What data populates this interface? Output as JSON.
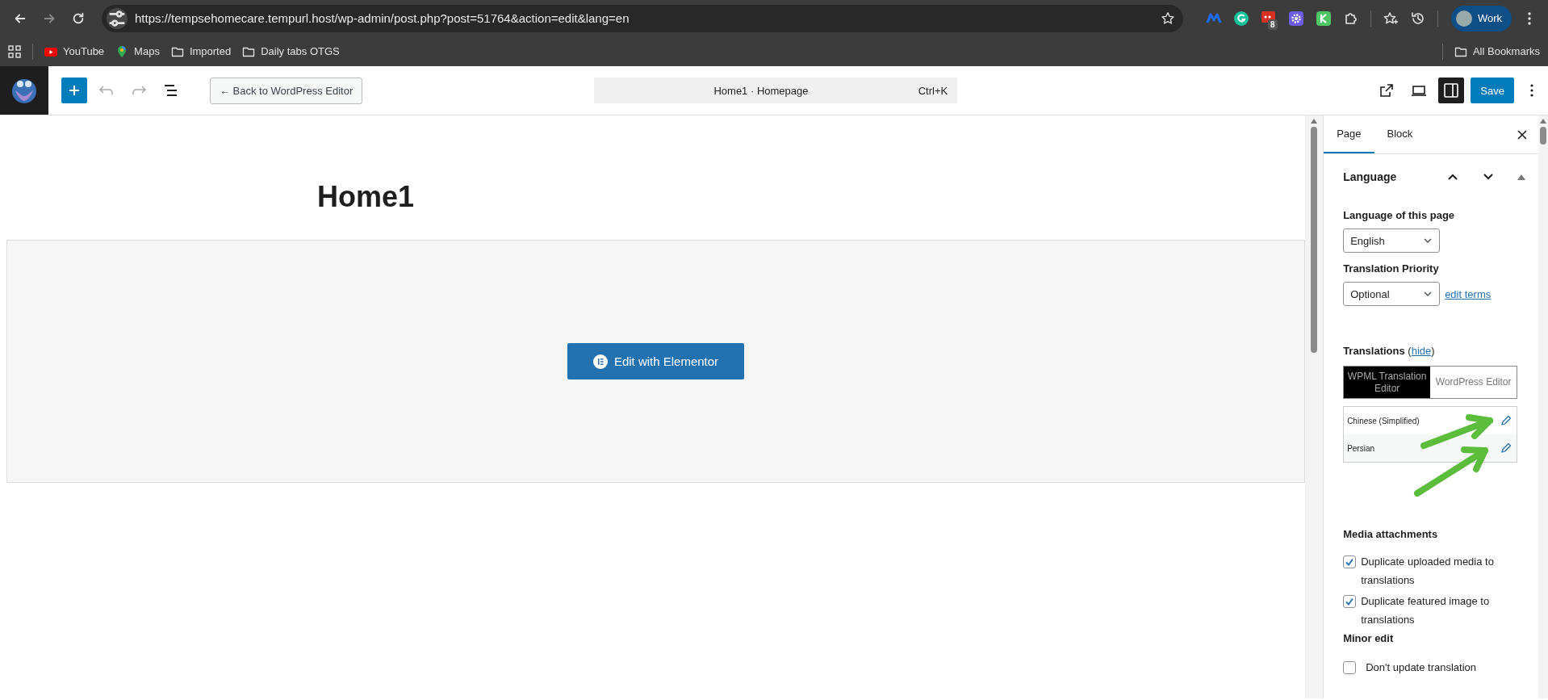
{
  "browser": {
    "url": "https://tempsehomecare.tempurl.host/wp-admin/post.php?post=51764&action=edit&lang=en",
    "extension_badge": "8",
    "profile": {
      "label": "Work"
    },
    "bookmarks": [
      {
        "label": "YouTube",
        "kind": "youtube"
      },
      {
        "label": "Maps",
        "kind": "maps"
      },
      {
        "label": "Imported",
        "kind": "folder"
      },
      {
        "label": "Daily tabs OTGS",
        "kind": "folder"
      }
    ],
    "all_bookmarks": "All Bookmarks"
  },
  "editor_toolbar": {
    "back_button": "← Back to WordPress Editor",
    "command_bar": {
      "title": "Home1 · Homepage",
      "shortcut": "Ctrl+K"
    },
    "settings_open": true,
    "save_button": "Save"
  },
  "canvas": {
    "page_title": "Home1",
    "elementor_button": "Edit with Elementor"
  },
  "sidebar": {
    "tabs": [
      {
        "label": "Page",
        "selected": true
      },
      {
        "label": "Block",
        "selected": false
      }
    ],
    "language_panel": {
      "title": "Language",
      "expanded": true,
      "language_label": "Language of this page",
      "language_value": "English",
      "priority_label": "Translation Priority",
      "priority_value": "Optional",
      "edit_terms_link": "edit terms",
      "translations_label": "Translations",
      "hide_open": "(",
      "hide_link": "hide",
      "hide_close": ")",
      "editor_choice": [
        {
          "label": "WPML Translation Editor",
          "selected": true
        },
        {
          "label": "WordPress Editor",
          "selected": false
        }
      ],
      "translations": [
        {
          "language": "Chinese (Simplified)"
        },
        {
          "language": "Persian"
        }
      ],
      "media_title": "Media attachments",
      "media_options": [
        {
          "label": "Duplicate uploaded media to translations",
          "checked": true
        },
        {
          "label": "Duplicate featured image to translations",
          "checked": true
        }
      ],
      "minor_edit_title": "Minor edit",
      "minor_edit_options": [
        {
          "label": "Don't update translation",
          "checked": false
        }
      ]
    }
  }
}
